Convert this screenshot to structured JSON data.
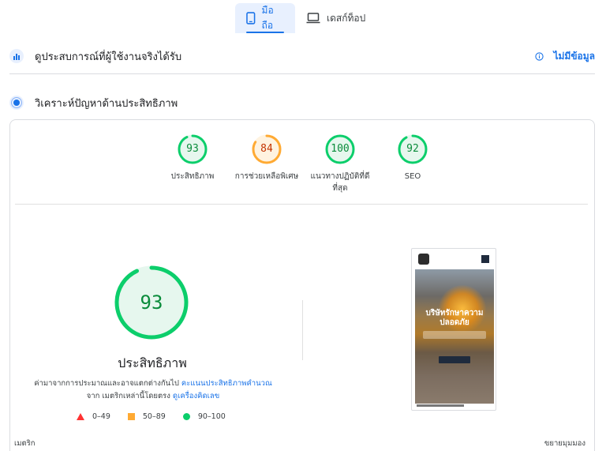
{
  "tabs": [
    {
      "label": "มือถือ",
      "icon": "phone-icon",
      "active": true
    },
    {
      "label": "เดสก์ท็อป",
      "icon": "laptop-icon",
      "active": false
    }
  ],
  "field_data": {
    "title": "ดูประสบการณ์ที่ผู้ใช้งานจริงได้รับ",
    "no_data_label": "ไม่มีข้อมูล",
    "icon": "field-data-icon"
  },
  "diagnose": {
    "title": "วิเคราะห์ปัญหาด้านประสิทธิภาพ",
    "icon": "lab-data-icon"
  },
  "scores": [
    {
      "value": 93,
      "label_lines": [
        "ประสิทธิภาพ"
      ],
      "status": "pass"
    },
    {
      "value": 84,
      "label_lines": [
        "การช่วยเหลือพิเศษ"
      ],
      "status": "average"
    },
    {
      "value": 100,
      "label_lines": [
        "แนวทางปฏิบัติที่ดี",
        "ที่สุด"
      ],
      "status": "pass"
    },
    {
      "value": 92,
      "label_lines": [
        "SEO"
      ],
      "status": "pass"
    }
  ],
  "main_score": {
    "value": 93,
    "title": "ประสิทธิภาพ",
    "desc_pre": "ค่ามาจากการประมาณและอาจแตกต่างกันไป ",
    "desc_link1": "คะแนนประสิทธิภาพคำนวณ",
    "desc_mid": "จาก เมตริกเหล่านี้โดยตรง ",
    "desc_link2": "ดูเครื่องคิดเลข"
  },
  "legend": [
    {
      "range": "0–49",
      "shape": "triangle",
      "color": "#ff3333"
    },
    {
      "range": "50–89",
      "shape": "square",
      "color": "#ffaa33"
    },
    {
      "range": "90–100",
      "shape": "circle",
      "color": "#0cce6b"
    }
  ],
  "colors": {
    "pass_ring": "#0cce6b",
    "pass_text": "#0a8c3b",
    "pass_fill": "#e6f7ee",
    "average_ring": "#ffaa33",
    "average_text": "#c33300",
    "average_fill": "#fff3e0",
    "track": "#e8f5ee",
    "accent": "#1a73e8"
  },
  "screenshot": {
    "headline_1": "บริษัทรักษาความ",
    "headline_2": "ปลอดภัย"
  },
  "footer": {
    "metrics_label": "เมตริก",
    "expand_label": "ขยายมุมมอง"
  }
}
